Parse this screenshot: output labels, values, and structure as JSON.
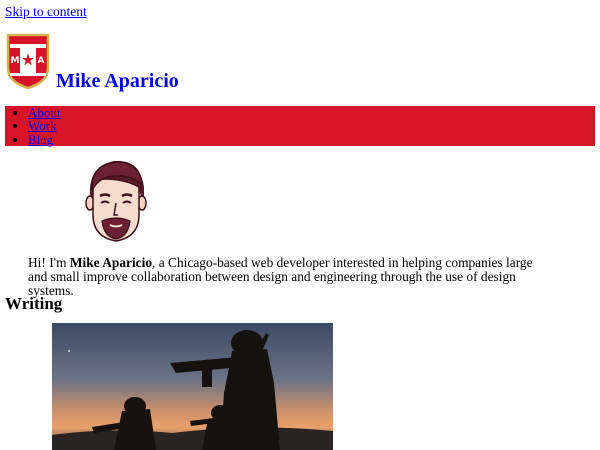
{
  "skip_link": "Skip to content",
  "header": {
    "title": "Mike Aparicio",
    "badge_letters": [
      "M",
      "A"
    ]
  },
  "nav": {
    "items": [
      {
        "label": "About"
      },
      {
        "label": "Work"
      },
      {
        "label": "Blog"
      }
    ]
  },
  "intro": {
    "prefix": "Hi! I'm ",
    "name": "Mike Aparicio",
    "suffix": ", a Chicago-based web developer interested in helping companies large and small improve collaboration between design and engineering through the use of design systems."
  },
  "writing": {
    "heading": "Writing"
  },
  "colors": {
    "brand_red": "#d61328",
    "link": "#0000ee"
  }
}
